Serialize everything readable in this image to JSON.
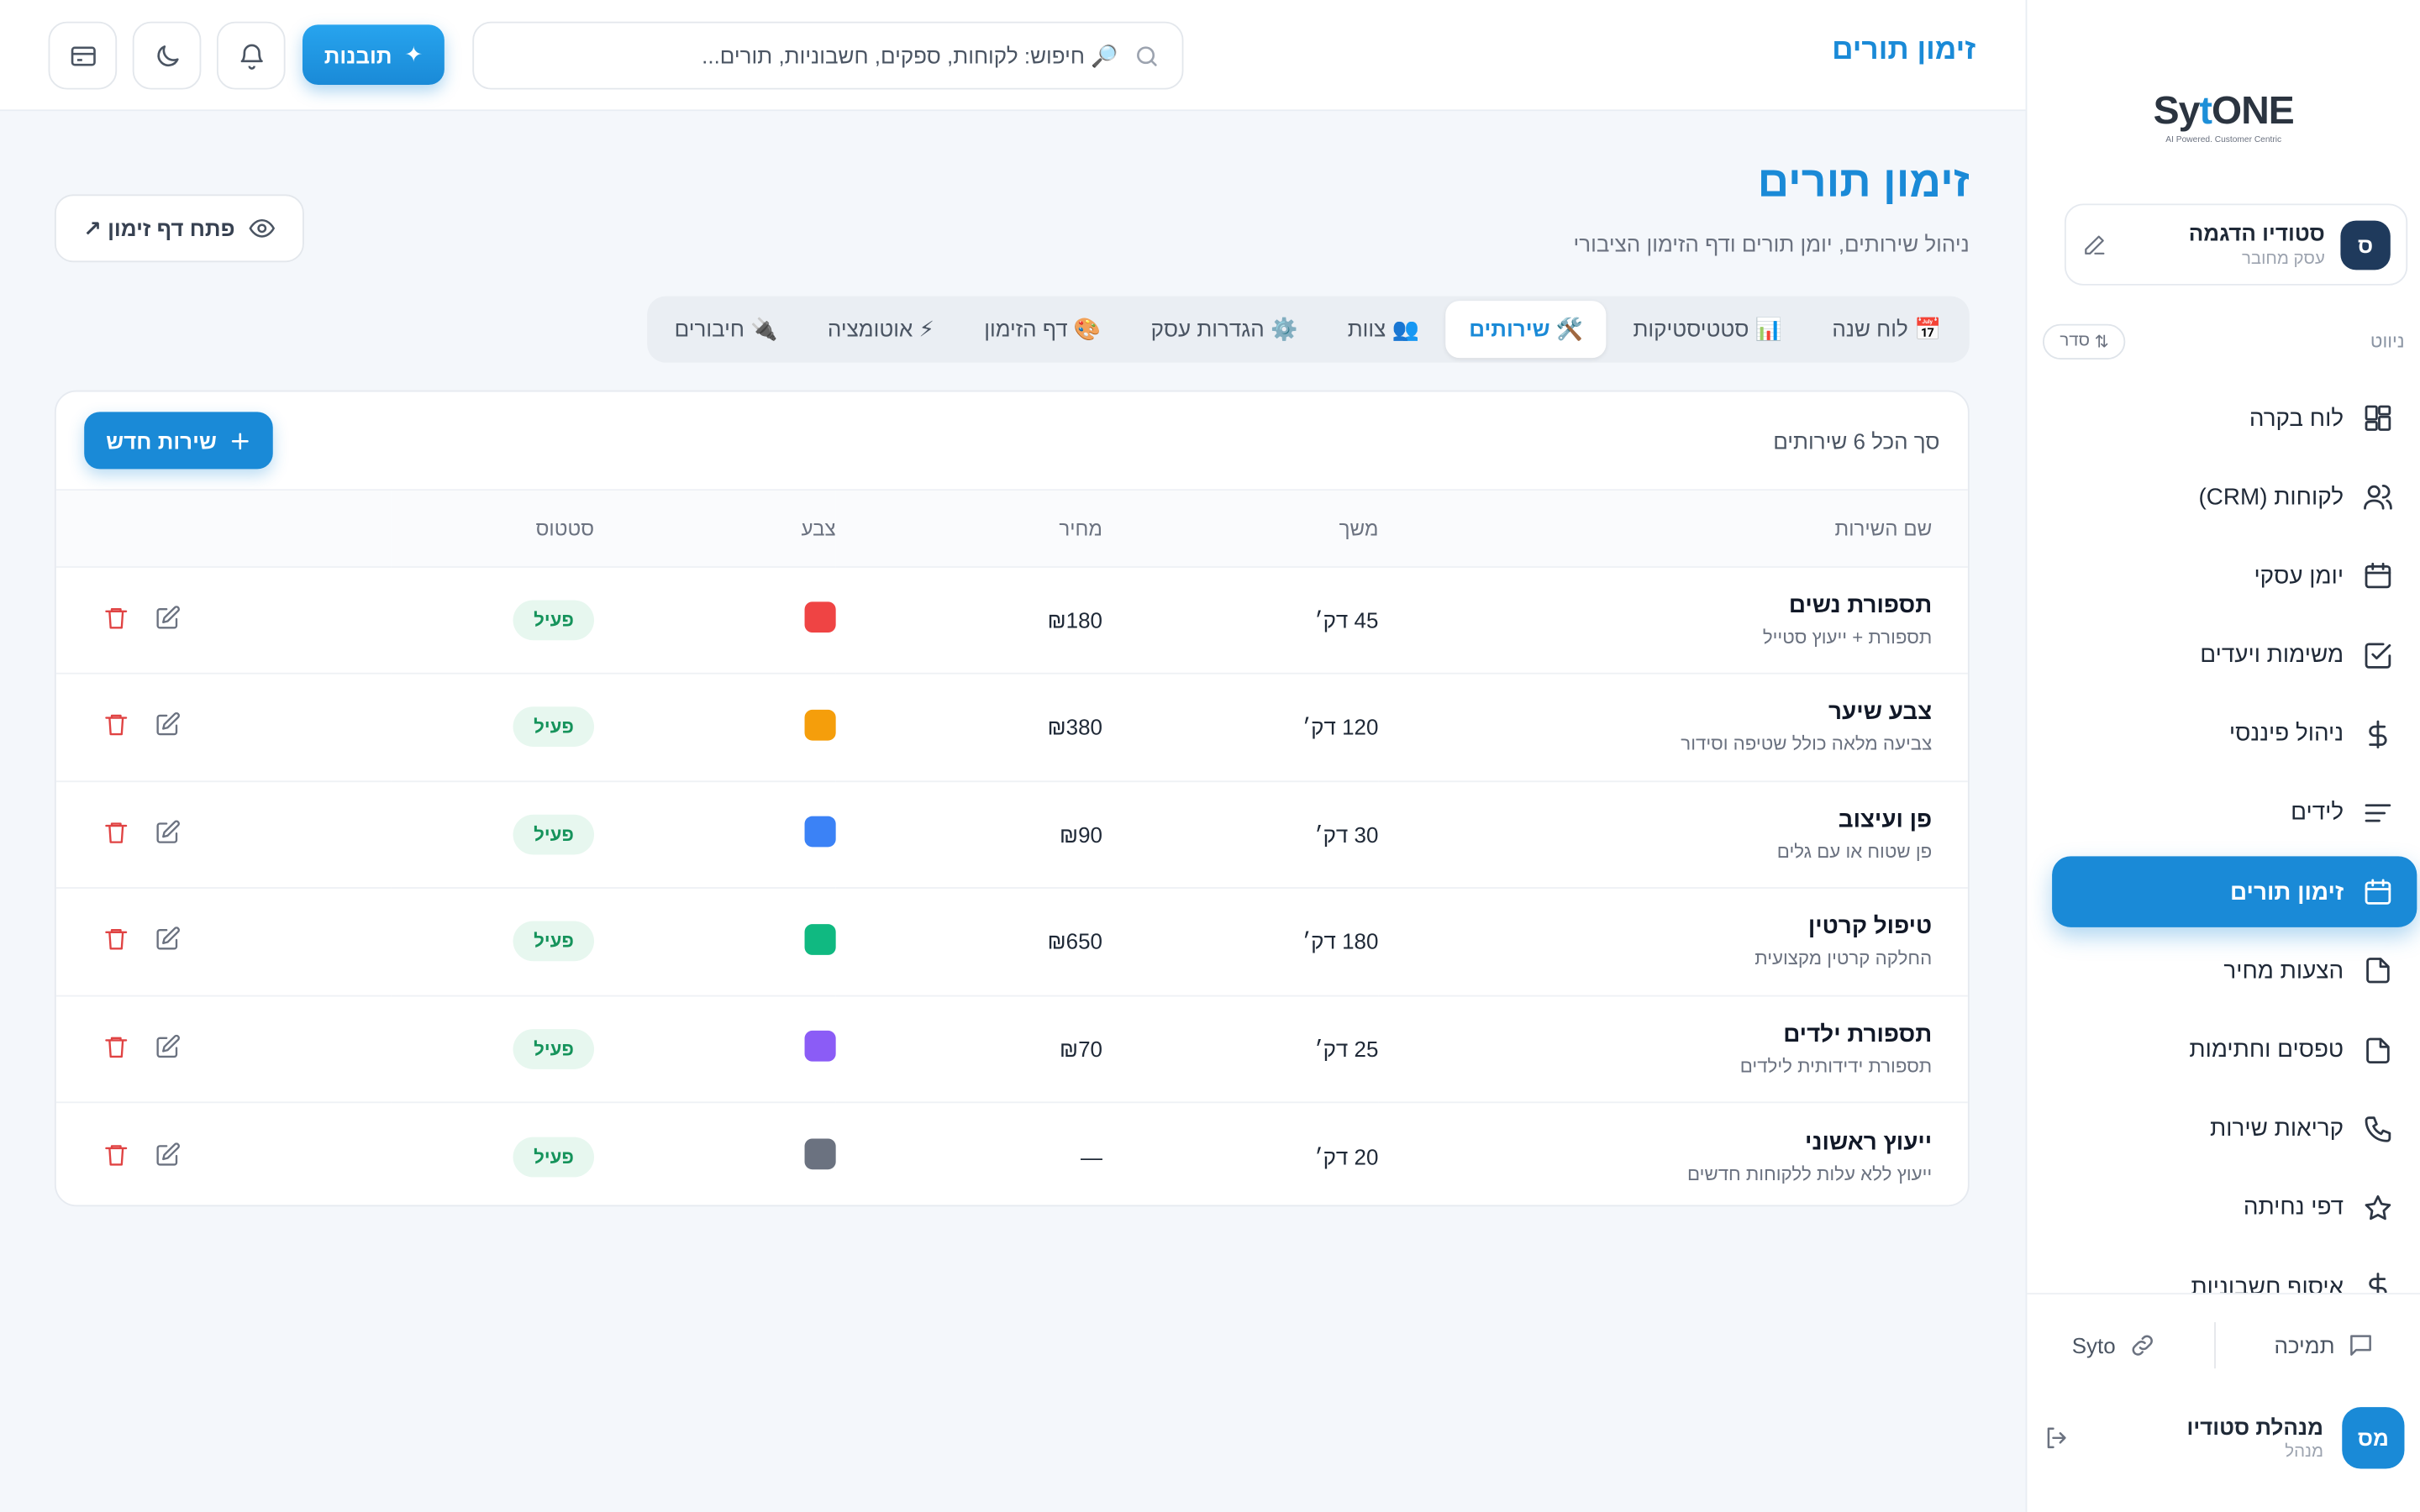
{
  "sidebar": {
    "logo_prefix": "Sy",
    "logo_t": "t",
    "logo_suffix": "ONE",
    "logo_tagline": "AI Powered. Customer Centric",
    "business": {
      "initial": "ס",
      "name": "סטודיו הדגמה",
      "status": "עסק מחובר"
    },
    "nav_title": "ניווט",
    "sort_label": "סדר",
    "items": [
      {
        "label": "לוח בקרה",
        "icon": "dashboard-icon"
      },
      {
        "label": "לקוחות (CRM)",
        "icon": "users-icon"
      },
      {
        "label": "יומן עסקי",
        "icon": "calendar-icon"
      },
      {
        "label": "משימות ויעדים",
        "icon": "checkbox-icon"
      },
      {
        "label": "ניהול פיננסי",
        "icon": "dollar-icon"
      },
      {
        "label": "לידים",
        "icon": "list-icon"
      },
      {
        "label": "זימון תורים",
        "icon": "calendar-icon",
        "active": true
      },
      {
        "label": "הצעות מחיר",
        "icon": "file-icon"
      },
      {
        "label": "טפסים וחתימות",
        "icon": "file-icon"
      },
      {
        "label": "קריאות שירות",
        "icon": "phone-icon"
      },
      {
        "label": "דפי נחיתה",
        "icon": "star-icon"
      },
      {
        "label": "איסוף חשבוניות",
        "icon": "dollar-icon"
      }
    ],
    "support_label": "תמיכה",
    "syto_label": "Syto",
    "user": {
      "initials": "מס",
      "name": "מנהלת סטודיו",
      "role": "מנהל"
    }
  },
  "topbar": {
    "title": "זימון תורים",
    "search_placeholder": "🔎 חיפוש: לקוחות, ספקים, חשבוניות, תורים...",
    "features_label": "תובנות"
  },
  "main": {
    "title": "זימון תורים",
    "subtitle": "ניהול שירותים, יומן תורים ודף הזימון הציבורי",
    "open_booking_label": "פתח דף זימון ↗",
    "tabs": [
      {
        "label": "📅 לוח שנה"
      },
      {
        "label": "📊 סטטיסטיקות"
      },
      {
        "label": "🛠️ שירותים",
        "active": true
      },
      {
        "label": "👥 צוות"
      },
      {
        "label": "⚙️ הגדרות עסק"
      },
      {
        "label": "🎨 דף הזימון"
      },
      {
        "label": "⚡ אוטומציה"
      },
      {
        "label": "🔌 חיבורים"
      }
    ],
    "total_label": "סך הכל 6 שירותים",
    "new_service_label": "שירות חדש",
    "columns": {
      "name": "שם השירות",
      "duration": "משך",
      "price": "מחיר",
      "color": "צבע",
      "status": "סטטוס"
    },
    "services": [
      {
        "name": "תספורת נשים",
        "desc": "תספורת + ייעוץ סטייל",
        "duration": "45 דק׳",
        "price": "₪180",
        "color": "#ef4444",
        "status": "פעיל"
      },
      {
        "name": "צבע שיער",
        "desc": "צביעה מלאה כולל שטיפה וסידור",
        "duration": "120 דק׳",
        "price": "₪380",
        "color": "#f59e0b",
        "status": "פעיל"
      },
      {
        "name": "פן ועיצוב",
        "desc": "פן שטוח או עם גלים",
        "duration": "30 דק׳",
        "price": "₪90",
        "color": "#3b82f6",
        "status": "פעיל"
      },
      {
        "name": "טיפול קרטין",
        "desc": "החלקה קרטין מקצועית",
        "duration": "180 דק׳",
        "price": "₪650",
        "color": "#10b981",
        "status": "פעיל"
      },
      {
        "name": "תספורת ילדים",
        "desc": "תספורת ידידותית לילדים",
        "duration": "25 דק׳",
        "price": "₪70",
        "color": "#8b5cf6",
        "status": "פעיל"
      },
      {
        "name": "ייעוץ ראשוני",
        "desc": "ייעוץ ללא עלות ללקוחות חדשים",
        "duration": "20 דק׳",
        "price": "—",
        "color": "#6b7280",
        "status": "פעיל"
      }
    ]
  }
}
